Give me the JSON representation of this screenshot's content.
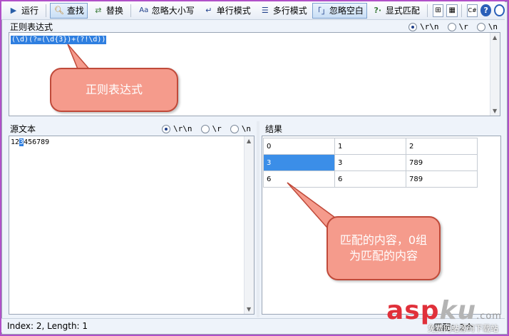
{
  "toolbar": {
    "run": "运行",
    "find": "查找",
    "replace": "替换",
    "ignore_case": "忽略大小写",
    "single_line": "单行模式",
    "multi_line": "多行模式",
    "ignore_space": "忽略空白",
    "explicit_capture": "显式匹配"
  },
  "regex_section": {
    "title": "正则表达式",
    "options": [
      "\\r\\n",
      "\\r",
      "\\n"
    ],
    "selected": "\\r\\n",
    "pattern": "(\\d)(?=(\\d{3})+(?!\\d))"
  },
  "source_section": {
    "title": "源文本",
    "options": [
      "\\r\\n",
      "\\r",
      "\\n"
    ],
    "selected": "\\r\\n",
    "text_before": "12",
    "text_selected": "3",
    "text_after": "456789"
  },
  "result_section": {
    "title": "结果",
    "columns": [
      "0",
      "1",
      "2"
    ],
    "rows": [
      [
        "3",
        "3",
        "789"
      ],
      [
        "6",
        "6",
        "789"
      ]
    ]
  },
  "status": {
    "left": "Index: 2, Length: 1",
    "right": "匹配：2个"
  },
  "callouts": {
    "regex": "正则表达式",
    "result_line1": "匹配的内容，0组",
    "result_line2": "为匹配的内容"
  },
  "watermark": {
    "asp": "asp",
    "ku": "ku",
    "com": ".com",
    "sub": "免费网站源码下载站"
  },
  "colors": {
    "callout_fill": "#f59b8c",
    "callout_border": "#c04a3a",
    "selection": "#2f7fe0",
    "frame_bg": "#b050c8"
  }
}
